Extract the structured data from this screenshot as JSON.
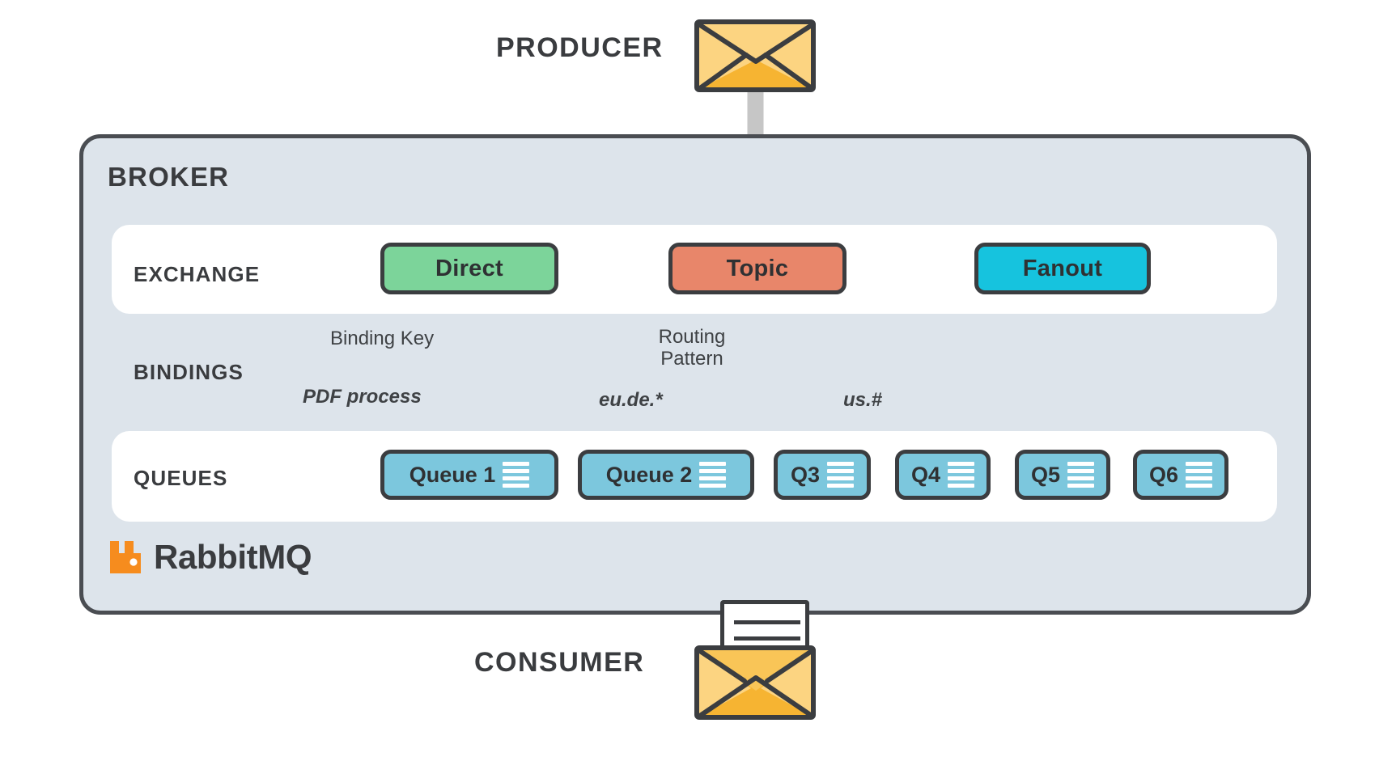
{
  "diagram": {
    "title": "RabbitMQ message broker exchange and queue routing"
  },
  "producer": {
    "label": "PRODUCER",
    "icon": "envelope-icon"
  },
  "consumer": {
    "label": "CONSUMER",
    "icon": "open-envelope-with-letter-icon"
  },
  "broker": {
    "label": "BROKER",
    "brand": "RabbitMQ",
    "brand_icon": "rabbitmq-logo-icon",
    "panel_color": "#dde4eb",
    "border_color": "#4a4d52"
  },
  "rows": {
    "exchange_label": "EXCHANGE",
    "bindings_label": "BINDINGS",
    "queues_label": "QUEUES"
  },
  "exchanges": [
    {
      "name": "Direct",
      "color": "#7cd49a",
      "arrow_color": "#7cd49a"
    },
    {
      "name": "Topic",
      "color": "#e8866a",
      "arrow_color": "#e8866a"
    },
    {
      "name": "Fanout",
      "color": "#16c3de",
      "arrow_color": "#16c3de"
    }
  ],
  "bindings": [
    {
      "type_label": "Binding Key",
      "value": "PDF process",
      "exchange": "Direct"
    },
    {
      "type_label_line1": "Routing",
      "type_label_line2": "Pattern",
      "value_left": "eu.de.*",
      "value_right": "us.#",
      "exchange": "Topic"
    }
  ],
  "queues": [
    {
      "name": "Queue 1"
    },
    {
      "name": "Queue 2"
    },
    {
      "name": "Q3"
    },
    {
      "name": "Q4"
    },
    {
      "name": "Q5"
    },
    {
      "name": "Q6"
    }
  ],
  "flow_arrows": {
    "producer_to_broker_color": "#c6c6c6",
    "broker_to_consumer_color": "#c6c6c6"
  },
  "colors": {
    "queue_fill": "#7cc7dd",
    "outline": "#3b3d40",
    "envelope_light": "#fcd481",
    "envelope_dark": "#f6b432",
    "rabbit_orange": "#f68c1e"
  }
}
